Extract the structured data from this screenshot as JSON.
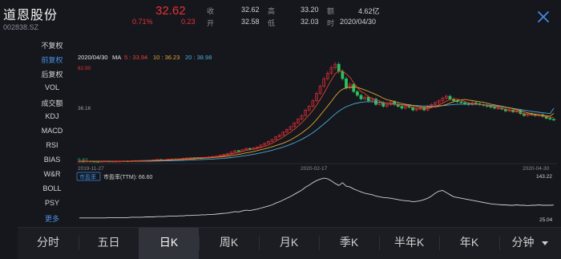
{
  "stock": {
    "name": "道恩股份",
    "code": "002838.SZ",
    "price": "32.62",
    "change_pct": "0.71%",
    "change": "0.23"
  },
  "quote": {
    "close_label": "收",
    "close": "32.62",
    "open_label": "开",
    "open": "32.58",
    "high_label": "高",
    "high": "33.20",
    "low_label": "低",
    "low": "32.03",
    "amount_label": "额",
    "amount": "4.62亿",
    "time_label": "时",
    "date": "2020/04/30"
  },
  "sidebar": {
    "items": [
      {
        "label": "不复权"
      },
      {
        "label": "前复权"
      },
      {
        "label": "后复权"
      },
      {
        "label": "VOL"
      },
      {
        "label": "成交额"
      },
      {
        "label": "KDJ"
      },
      {
        "label": "MACD"
      },
      {
        "label": "RSI"
      },
      {
        "label": "BIAS"
      },
      {
        "label": "W&R"
      },
      {
        "label": "BOLL"
      },
      {
        "label": "PSY"
      },
      {
        "label": "更多"
      }
    ],
    "active_index": 1
  },
  "chart_data": [
    {
      "type": "candlestick",
      "ma_legend": {
        "date": "2020/04/30",
        "prefix": "MA",
        "ma5_label": "5 : 33.94",
        "ma10_label": "10 : 36.23",
        "ma20_label": "20 : 38.98"
      },
      "colors": {
        "ma5": "#e0452e",
        "ma10": "#e0a431",
        "ma20": "#4aa8d8",
        "up": "#e8303a",
        "down": "#2bbf5e"
      },
      "y_labels": {
        "max": "62.90",
        "mid": "36.16",
        "min": "9.82"
      },
      "x_labels": [
        "2019-11-27",
        "2020-02-17",
        "2020-04-30"
      ],
      "ylim": [
        9.82,
        62.9
      ],
      "close": [
        10.2,
        10.1,
        10.3,
        10.2,
        10.1,
        10.0,
        10.2,
        10.3,
        10.1,
        10.2,
        10.2,
        10.3,
        10.4,
        10.3,
        10.5,
        10.6,
        10.5,
        10.7,
        10.6,
        10.8,
        11.0,
        11.2,
        10.9,
        11.0,
        11.3,
        11.5,
        11.4,
        11.6,
        11.8,
        12.0,
        12.2,
        12.1,
        12.3,
        12.2,
        12.4,
        12.6,
        12.8,
        13.0,
        13.5,
        14.0,
        14.5,
        15.2,
        16.0,
        15.6,
        16.5,
        17.2,
        16.8,
        17.5,
        18.0,
        19.0,
        20.0,
        21.0,
        22.0,
        23.5,
        24.5,
        26.0,
        27.5,
        29.0,
        31.0,
        33.0,
        35.0,
        38.0,
        40.0,
        43.0,
        47.0,
        51.0,
        55.0,
        58.0,
        61.0,
        62.9,
        59.0,
        55.0,
        50.0,
        52.0,
        48.0,
        46.0,
        44.0,
        45.0,
        43.0,
        44.0,
        41.0,
        42.0,
        40.0,
        41.0,
        42.5,
        41.0,
        40.0,
        39.0,
        40.0,
        39.5,
        38.0,
        38.5,
        39.0,
        38.0,
        40.0,
        41.0,
        42.0,
        43.0,
        44.5,
        45.5,
        44.0,
        43.0,
        42.5,
        42.0,
        41.5,
        41.0,
        42.0,
        41.5,
        41.0,
        40.5,
        40.0,
        39.5,
        39.0,
        39.0,
        38.5,
        37.5,
        38.0,
        37.0,
        37.5,
        36.0,
        35.0,
        36.0,
        35.5,
        35.0,
        35.5,
        34.5,
        33.5,
        33.0,
        32.62
      ],
      "ma5": [
        10.2,
        10.15,
        10.2,
        10.2,
        10.18,
        10.14,
        10.16,
        10.18,
        10.16,
        10.2,
        10.2,
        10.22,
        10.24,
        10.28,
        10.34,
        10.42,
        10.46,
        10.52,
        10.58,
        10.64,
        10.72,
        10.86,
        10.9,
        10.98,
        11.08,
        11.18,
        11.22,
        11.36,
        11.52,
        11.66,
        11.8,
        11.94,
        12.08,
        12.16,
        12.24,
        12.32,
        12.46,
        12.6,
        12.86,
        13.18,
        13.56,
        14.04,
        14.64,
        15.06,
        15.56,
        16.1,
        16.42,
        16.72,
        17.2,
        17.7,
        18.3,
        19.1,
        20.0,
        21.1,
        22.2,
        23.4,
        24.7,
        26.1,
        27.6,
        29.3,
        31.1,
        33.2,
        35.4,
        37.8,
        40.6,
        43.8,
        47.2,
        50.8,
        54.4,
        57.6,
        59.2,
        59.2,
        57.6,
        55.8,
        52.8,
        50.2,
        48.0,
        47.0,
        45.2,
        44.4,
        43.4,
        43.0,
        42.0,
        41.8,
        41.3,
        41.2,
        40.9,
        40.7,
        40.6,
        40.2,
        39.4,
        39.0,
        39.0,
        38.6,
        38.8,
        39.3,
        40.0,
        40.8,
        41.7,
        42.8,
        43.8,
        44.0,
        43.9,
        43.4,
        42.6,
        41.9,
        41.5,
        41.3,
        41.0,
        40.8,
        40.5,
        40.1,
        39.8,
        39.4,
        38.9,
        38.4,
        38.1,
        37.7,
        37.3,
        36.6,
        35.9,
        35.7,
        35.4,
        35.2,
        35.1,
        34.9,
        34.4,
        34.0,
        33.94
      ],
      "ma10": [
        10.2,
        10.2,
        10.2,
        10.2,
        10.2,
        10.18,
        10.17,
        10.18,
        10.16,
        10.17,
        10.17,
        10.19,
        10.21,
        10.23,
        10.26,
        10.31,
        10.35,
        10.4,
        10.46,
        10.52,
        10.58,
        10.67,
        10.71,
        10.78,
        10.86,
        10.95,
        11.04,
        11.14,
        11.25,
        11.37,
        11.49,
        11.57,
        11.72,
        11.87,
        11.98,
        12.08,
        12.21,
        12.37,
        12.52,
        12.73,
        12.96,
        13.25,
        13.6,
        13.94,
        14.32,
        14.76,
        15.1,
        15.54,
        15.99,
        16.47,
        16.93,
        17.5,
        18.04,
        18.69,
        19.34,
        20.02,
        20.88,
        21.8,
        22.98,
        24.22,
        25.52,
        27.04,
        28.66,
        30.56,
        32.8,
        35.2,
        37.7,
        40.2,
        42.7,
        45.4,
        47.8,
        49.3,
        50.0,
        50.4,
        50.5,
        50.3,
        49.6,
        48.9,
        48.1,
        47.3,
        46.4,
        45.5,
        44.4,
        43.6,
        43.2,
        42.7,
        42.1,
        41.6,
        41.1,
        40.9,
        40.5,
        40.0,
        39.7,
        39.4,
        39.5,
        39.6,
        39.7,
        40.0,
        40.4,
        41.0,
        41.8,
        42.5,
        43.2,
        43.6,
        43.7,
        43.4,
        43.1,
        42.8,
        42.5,
        42.2,
        41.7,
        41.2,
        40.8,
        40.4,
        40.0,
        39.6,
        39.2,
        38.7,
        38.2,
        37.7,
        37.0,
        36.5,
        36.1,
        35.7,
        35.4,
        35.2,
        34.9,
        34.6,
        36.23
      ],
      "ma20": [
        10.2,
        10.2,
        10.2,
        10.2,
        10.2,
        10.2,
        10.2,
        10.2,
        10.2,
        10.2,
        10.2,
        10.2,
        10.2,
        10.2,
        10.2,
        10.2,
        10.2,
        10.22,
        10.24,
        10.26,
        10.3,
        10.34,
        10.38,
        10.42,
        10.47,
        10.52,
        10.57,
        10.63,
        10.7,
        10.77,
        10.85,
        10.93,
        11.02,
        11.11,
        11.2,
        11.29,
        11.4,
        11.52,
        11.66,
        11.82,
        12.0,
        12.22,
        12.48,
        12.74,
        13.04,
        13.36,
        13.66,
        14.0,
        14.36,
        14.76,
        15.2,
        15.66,
        16.16,
        16.72,
        17.3,
        17.92,
        18.62,
        19.36,
        20.2,
        21.12,
        22.1,
        23.2,
        24.4,
        25.7,
        27.2,
        28.8,
        30.5,
        32.2,
        34.0,
        35.8,
        37.4,
        38.7,
        39.8,
        40.6,
        41.3,
        41.8,
        42.2,
        42.4,
        42.5,
        42.5,
        42.4,
        42.2,
        41.9,
        41.7,
        41.5,
        41.3,
        41.1,
        40.9,
        40.7,
        40.6,
        40.5,
        40.4,
        40.3,
        40.2,
        40.2,
        40.2,
        40.2,
        40.3,
        40.4,
        40.6,
        40.8,
        41.0,
        41.1,
        41.2,
        41.2,
        41.2,
        41.2,
        41.1,
        41.0,
        40.9,
        40.7,
        40.5,
        40.3,
        40.1,
        39.8,
        39.5,
        39.2,
        38.9,
        38.6,
        38.3,
        37.9,
        37.6,
        37.3,
        37.0,
        36.8,
        36.5,
        36.3,
        36.0,
        38.98
      ]
    },
    {
      "type": "line",
      "indicator_button": "市盈率",
      "label": "市盈率(TTM): 66.60",
      "y_labels": {
        "max": "143.22",
        "min": "25.04"
      },
      "ylim": [
        25.04,
        143.22
      ],
      "values": [
        30,
        30,
        30,
        30,
        30,
        30,
        30,
        30,
        31,
        31,
        31,
        31,
        31,
        31,
        32,
        32,
        32,
        32,
        33,
        33,
        33,
        34,
        34,
        34,
        35,
        35,
        35,
        36,
        36,
        37,
        37,
        38,
        38,
        39,
        39,
        40,
        40,
        41,
        42,
        43,
        44,
        46,
        48,
        47,
        50,
        52,
        51,
        53,
        55,
        58,
        61,
        64,
        67,
        72,
        76,
        81,
        86,
        91,
        97,
        103,
        109,
        117,
        123,
        130,
        136,
        140,
        143,
        141,
        135,
        128,
        122,
        130,
        120,
        118,
        112,
        108,
        104,
        100,
        98,
        96,
        92,
        90,
        88,
        87,
        86,
        84,
        82,
        80,
        79,
        78,
        76,
        77,
        79,
        82,
        86,
        92,
        100,
        106,
        108,
        102,
        96,
        90,
        88,
        86,
        84,
        82,
        80,
        78,
        76,
        74,
        72,
        70,
        69,
        68,
        67,
        67,
        66,
        66,
        67,
        66,
        66,
        65,
        66,
        66,
        67,
        66,
        66,
        66,
        66.6
      ]
    }
  ],
  "tabs": [
    {
      "label": "分时"
    },
    {
      "label": "五日"
    },
    {
      "label": "日K"
    },
    {
      "label": "周K"
    },
    {
      "label": "月K"
    },
    {
      "label": "季K"
    },
    {
      "label": "半年K"
    },
    {
      "label": "年K"
    },
    {
      "label": "分钟"
    }
  ],
  "active_tab": 2
}
